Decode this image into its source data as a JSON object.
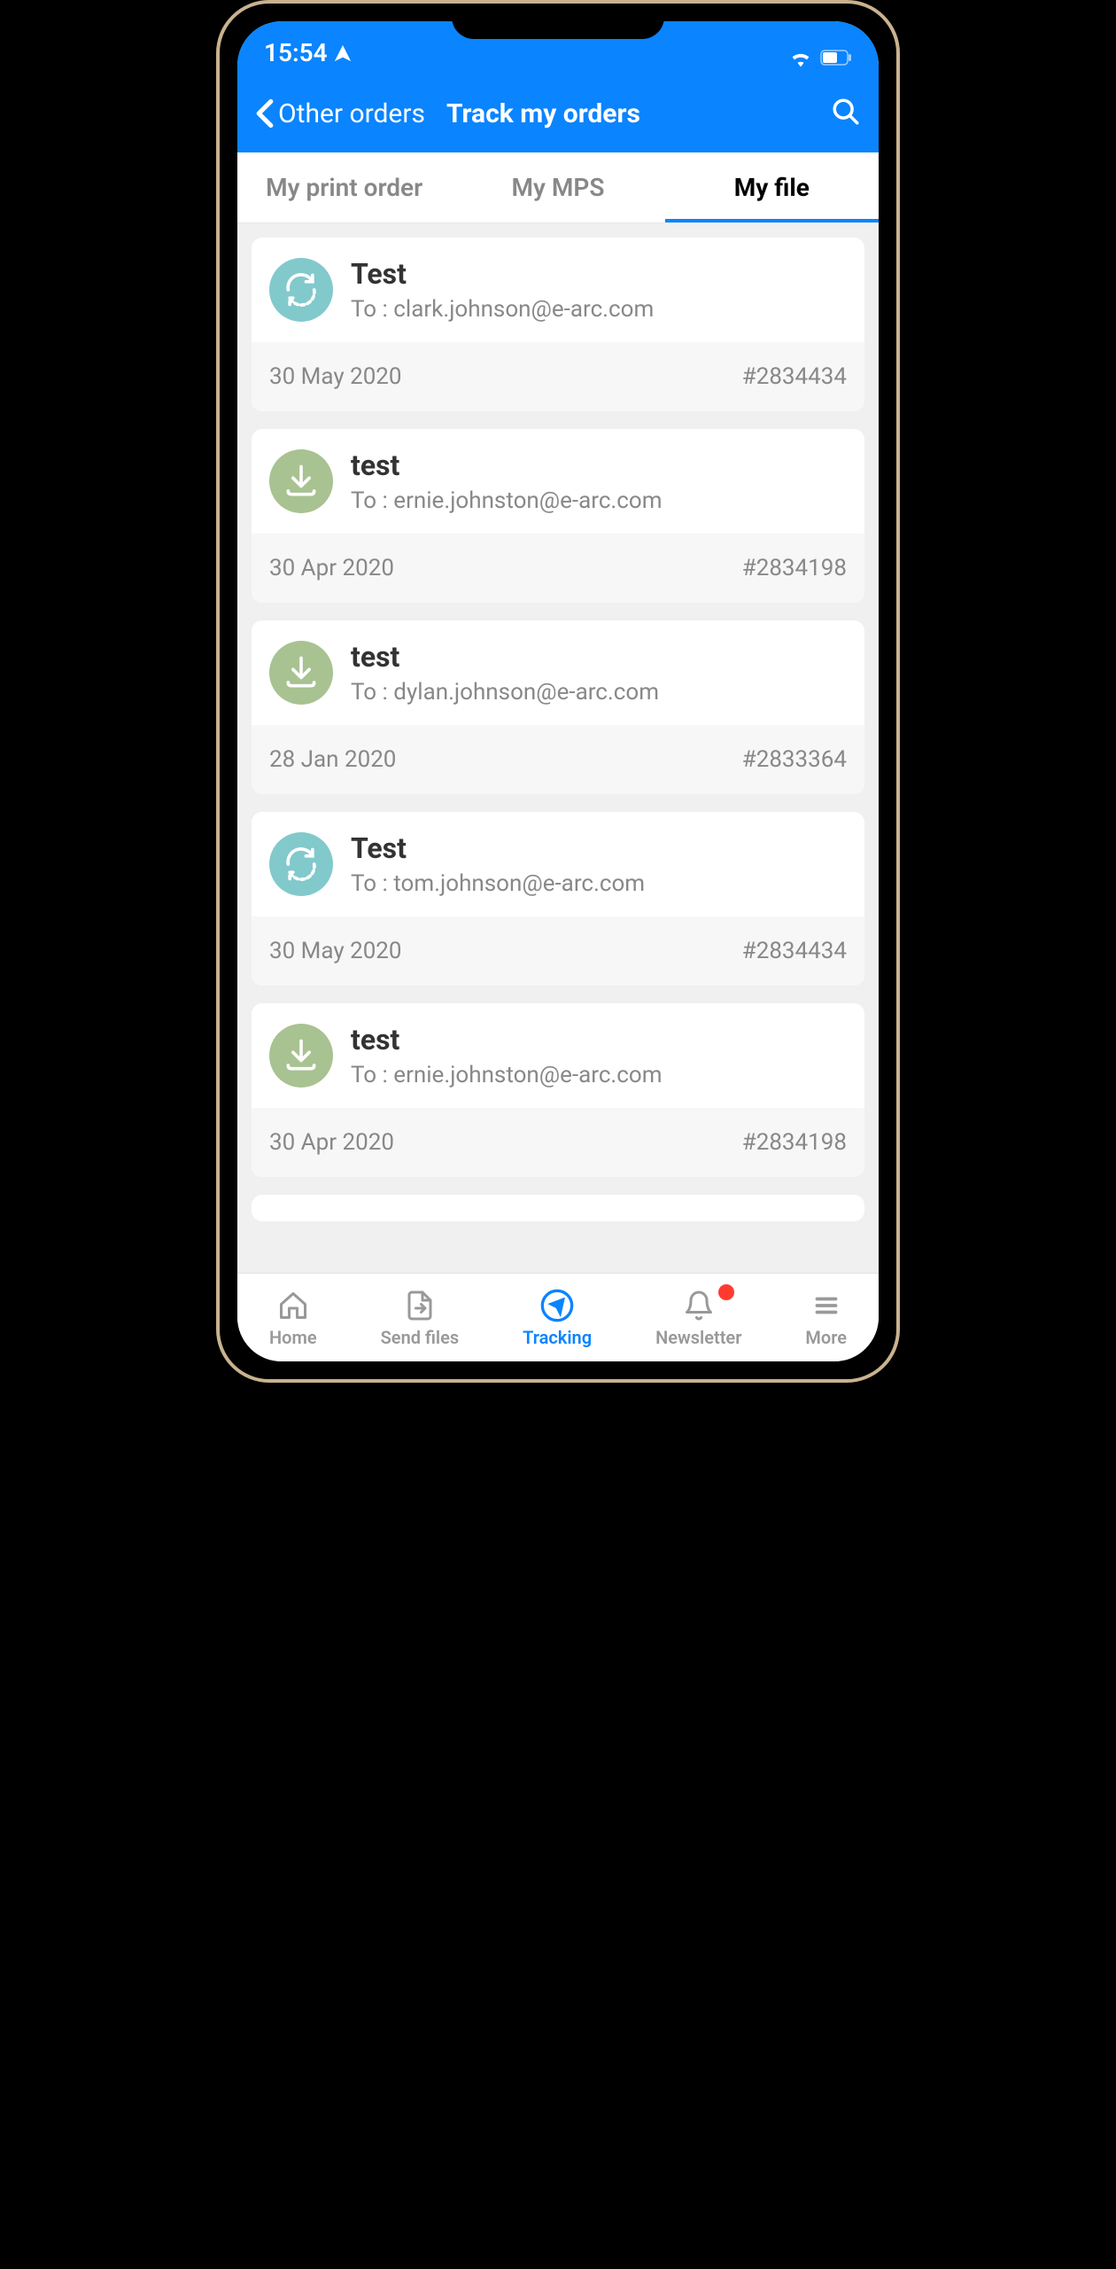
{
  "status": {
    "time": "15:54"
  },
  "header": {
    "back_label": "Other orders",
    "title": "Track my orders"
  },
  "tabs": [
    {
      "label": "My print order",
      "active": false
    },
    {
      "label": "My MPS",
      "active": false
    },
    {
      "label": "My file",
      "active": true
    }
  ],
  "files": [
    {
      "icon": "sync",
      "title": "Test",
      "to_prefix": "To : ",
      "recipient": "clark.johnson@e-arc.com",
      "date": "30 May 2020",
      "id": "#2834434"
    },
    {
      "icon": "download",
      "title": "test",
      "to_prefix": "To : ",
      "recipient": "ernie.johnston@e-arc.com",
      "date": "30 Apr 2020",
      "id": "#2834198"
    },
    {
      "icon": "download",
      "title": "test",
      "to_prefix": "To :  ",
      "recipient": "dylan.johnson@e-arc.com",
      "date": "28 Jan 2020",
      "id": "#2833364"
    },
    {
      "icon": "sync",
      "title": "Test",
      "to_prefix": "To :   ",
      "recipient": "tom.johnson@e-arc.com",
      "date": "30 May 2020",
      "id": "#2834434"
    },
    {
      "icon": "download",
      "title": "test",
      "to_prefix": "To : ",
      "recipient": "ernie.johnston@e-arc.com",
      "date": "30 Apr 2020",
      "id": "#2834198"
    }
  ],
  "nav": [
    {
      "label": "Home",
      "icon": "home",
      "active": false
    },
    {
      "label": "Send files",
      "icon": "send-files",
      "active": false
    },
    {
      "label": "Tracking",
      "icon": "tracking",
      "active": true
    },
    {
      "label": "Newsletter",
      "icon": "newsletter",
      "active": false,
      "badge": true
    },
    {
      "label": "More",
      "icon": "more",
      "active": false
    }
  ]
}
